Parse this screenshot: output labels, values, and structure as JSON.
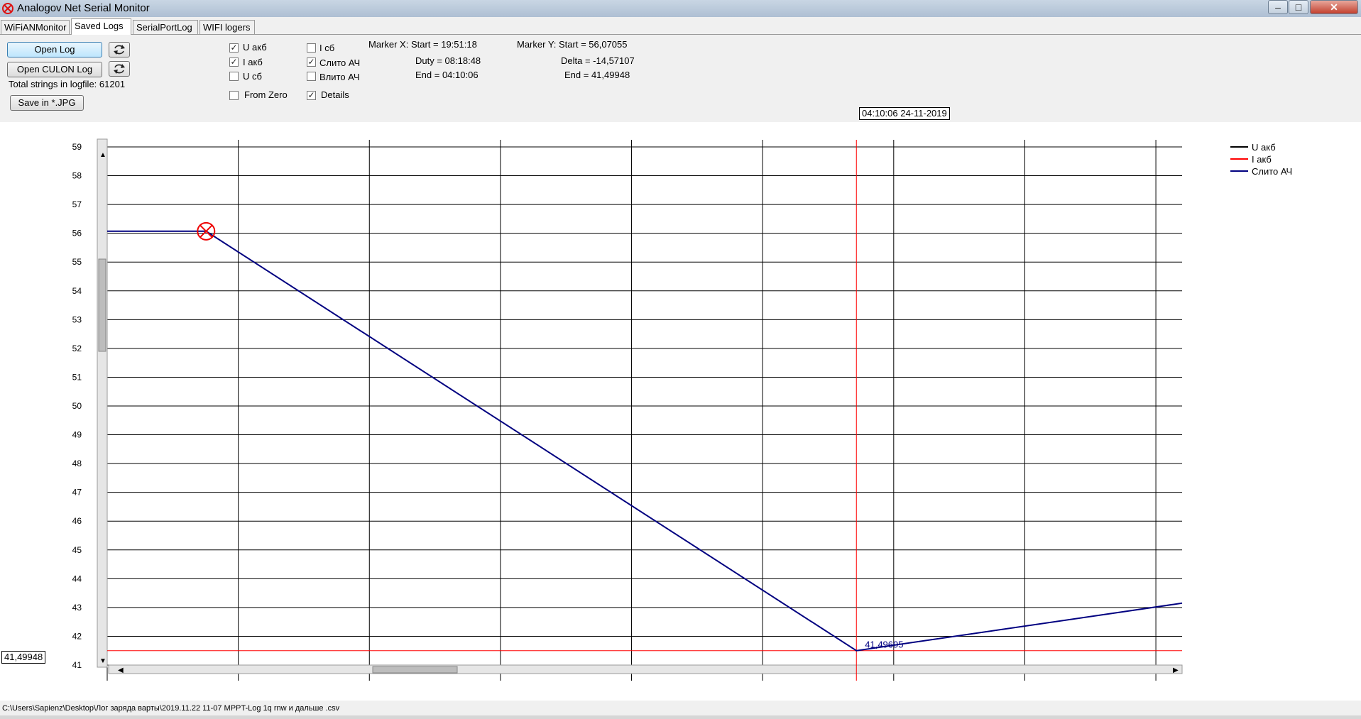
{
  "window": {
    "title": "Analogov Net Serial Monitor",
    "minimize": "–",
    "maximize": "□",
    "close": "✕"
  },
  "tabs": [
    {
      "label": "WiFiANMonitor",
      "active": false
    },
    {
      "label": "Saved Logs",
      "active": true
    },
    {
      "label": "SerialPortLog",
      "active": false
    },
    {
      "label": "WIFI logers",
      "active": false
    }
  ],
  "controls": {
    "open_log": "Open Log",
    "open_culon_log": "Open CULON Log",
    "total_strings": "Total strings in logfile: 61201",
    "save_jpg": "Save in *.JPG",
    "refresh_icon": "refresh-icon"
  },
  "checkboxes": {
    "u_akb": {
      "label": "U акб",
      "checked": true
    },
    "i_akb": {
      "label": "I акб",
      "checked": true
    },
    "u_sb": {
      "label": "U сб",
      "checked": false
    },
    "from_zero": {
      "label": "From Zero",
      "checked": false
    },
    "i_sb": {
      "label": "I сб",
      "checked": false
    },
    "slito_ah": {
      "label": "Слито АЧ",
      "checked": true
    },
    "vlito_ah": {
      "label": "Влито АЧ",
      "checked": false
    },
    "details": {
      "label": "Details",
      "checked": true
    }
  },
  "marker_x": {
    "start": "Marker X: Start = 19:51:18",
    "duty": "Duty = 08:18:48",
    "end": "End  = 04:10:06"
  },
  "marker_y": {
    "start": "Marker Y: Start = 56,07055",
    "delta": "Delta = -14,57107",
    "end": "End  = 41,49948"
  },
  "cursor_tooltip": "04:10:06 24-11-2019",
  "cursor_value_box": "41,49948",
  "status_path": "C:\\Users\\Sapienz\\Desktop\\Лог заряда варты\\2019.11.22 11-07 MPPT-Log 1q rnw и дальше .csv",
  "chart_data": {
    "type": "line",
    "ylim": [
      41,
      59
    ],
    "y_ticks": [
      "59",
      "58",
      "57",
      "56",
      "55",
      "54",
      "53",
      "52",
      "51",
      "50",
      "49",
      "48",
      "47",
      "46",
      "45",
      "44",
      "43",
      "42",
      "41"
    ],
    "x_gridlines": 9,
    "legend": [
      {
        "name": "U акб",
        "color": "#000000"
      },
      {
        "name": "I акб",
        "color": "#ff0000"
      },
      {
        "name": "Слито АЧ",
        "color": "#000080"
      }
    ],
    "legend_position": "top-right",
    "series": [
      {
        "name": "Слито АЧ",
        "color": "#000080",
        "points": [
          [
            0.0,
            56.07
          ],
          [
            0.092,
            56.07
          ],
          [
            0.697,
            41.5
          ],
          [
            1.0,
            43.15
          ]
        ]
      }
    ],
    "horizontal_marker": {
      "y": 41.49948,
      "color": "#ff0000"
    },
    "vertical_marker": {
      "x_fraction": 0.697,
      "color": "#ff0000"
    },
    "start_marker": {
      "x_fraction": 0.092,
      "y": 56.07
    },
    "point_label": "41,49695"
  }
}
